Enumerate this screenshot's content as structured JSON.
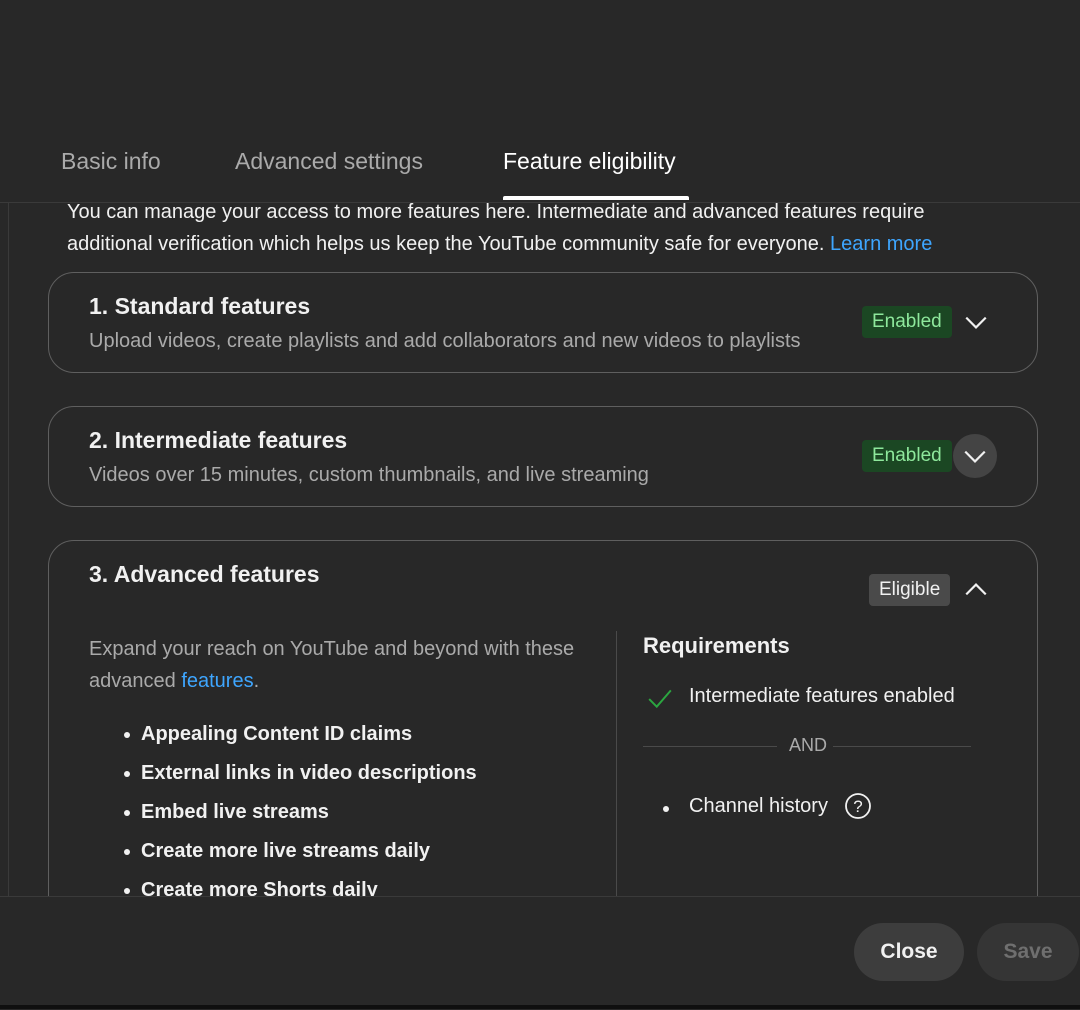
{
  "tabs": [
    {
      "label": "Basic info",
      "active": false
    },
    {
      "label": "Advanced settings",
      "active": false
    },
    {
      "label": "Feature eligibility",
      "active": true
    }
  ],
  "intro": {
    "line1": "You can manage your access to more features here. Intermediate and advanced features require",
    "line2": "additional verification which helps us keep the YouTube community safe for everyone.",
    "link": "Learn more"
  },
  "cards": [
    {
      "title": "1. Standard features",
      "subtitle": "Upload videos, create playlists and add collaborators and new videos to playlists",
      "badge": "Enabled",
      "expanded": false
    },
    {
      "title": "2. Intermediate features",
      "subtitle": "Videos over 15 minutes, custom thumbnails, and live streaming",
      "badge": "Enabled",
      "expanded": false
    },
    {
      "title": "3. Advanced features",
      "badge": "Eligible",
      "expanded": true,
      "desc_prefix": "Expand your reach on YouTube and beyond with these advanced",
      "desc_link": "features",
      "desc_suffix": ".",
      "features": [
        "Appealing Content ID claims",
        "External links in video descriptions",
        "Embed live streams",
        "Create more live streams daily",
        "Create more Shorts daily"
      ],
      "requirements": {
        "title": "Requirements",
        "met": "Intermediate features enabled",
        "and_label": "AND",
        "pending": "Channel history"
      }
    }
  ],
  "footer": {
    "close_label": "Close",
    "save_label": "Save"
  },
  "colors": {
    "background": "#282828",
    "accent_link": "#3ea6ff",
    "enabled_badge": "#1b4723",
    "enabled_text": "#8ee89c",
    "check": "#2ba640"
  }
}
